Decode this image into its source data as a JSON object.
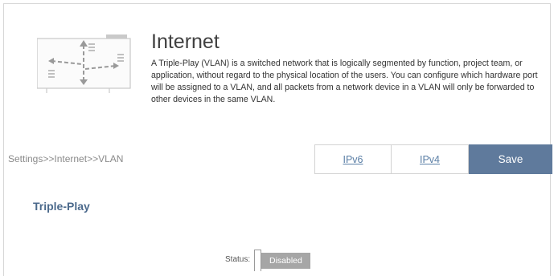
{
  "header": {
    "icon_name": "vlan-network-illustration",
    "title": "Internet",
    "description": "A Triple-Play (VLAN) is a switched network that is logically segmented by function, project team, or application, without regard to the physical location of the users. You can configure which hardware port will be assigned to a VLAN, and all packets from a network device in a VLAN will only be forwarded to other devices in the same VLAN."
  },
  "breadcrumb": "Settings>>Internet>>VLAN",
  "toolbar": {
    "tabs": [
      {
        "label": "IPv6"
      },
      {
        "label": "IPv4"
      }
    ],
    "save_label": "Save"
  },
  "section": {
    "title": "Triple-Play",
    "status_label": "Status:",
    "status_value": "Disabled"
  },
  "colors": {
    "accent": "#5f7a9c",
    "link": "#5b7fa6",
    "toggle_off": "#a6a6a6"
  }
}
